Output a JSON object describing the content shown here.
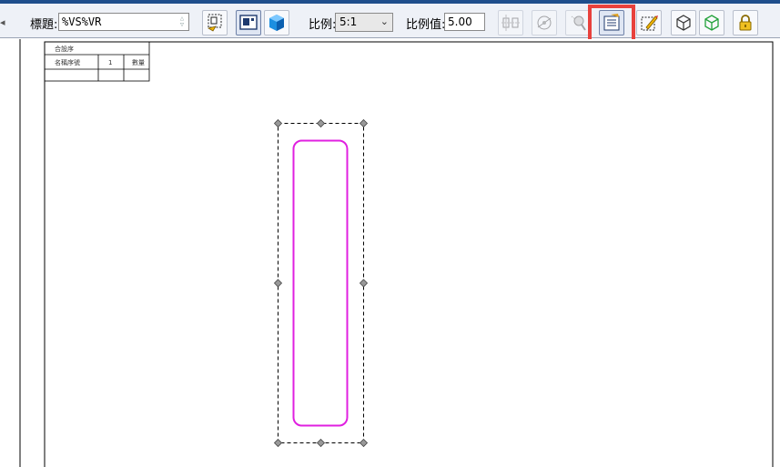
{
  "toolbar": {
    "title_label": "標題:",
    "title_value": "%VS%VR",
    "scale_label": "比例:",
    "scale_selected": "5:1",
    "scale_value_label": "比例值:",
    "scale_value": "5.00",
    "buttons": [
      {
        "icon": "insert-view-icon"
      },
      {
        "icon": "drawing-view-layout-icon"
      },
      {
        "icon": "3d-cube-icon"
      },
      {
        "icon": "align-views-icon"
      },
      {
        "icon": "section-view-icon"
      },
      {
        "icon": "magnify-view-icon"
      },
      {
        "icon": "properties-list-icon"
      },
      {
        "icon": "edit-pencil-icon"
      },
      {
        "icon": "cube-wireframe-icon"
      },
      {
        "icon": "cube-shaded-green-icon"
      },
      {
        "icon": "lock-icon"
      }
    ]
  },
  "title_block": {
    "header": "合設序",
    "col1": "名稱序號",
    "col2": "1",
    "col3": "數量"
  },
  "colors": {
    "accent_border": "#e8413c",
    "part_outline": "#e020e0",
    "toolbar_bg": "#eef1f7"
  }
}
